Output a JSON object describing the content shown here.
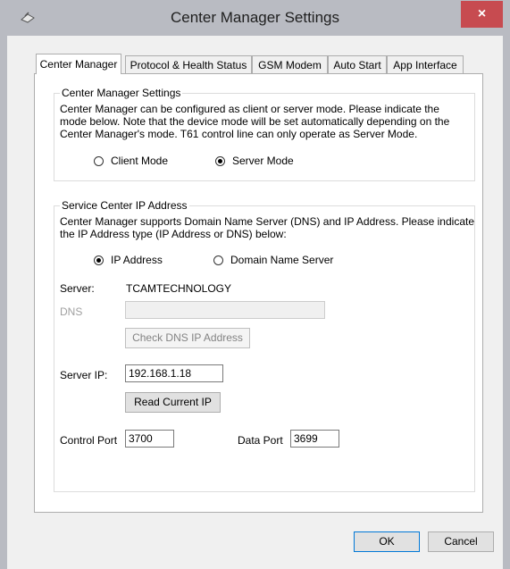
{
  "window": {
    "title": "Center Manager Settings",
    "close_glyph": "×",
    "icon": "app-icon"
  },
  "tabs": [
    {
      "label": "Center Manager",
      "active": true
    },
    {
      "label": "Protocol & Health Status",
      "active": false
    },
    {
      "label": "GSM Modem",
      "active": false
    },
    {
      "label": "Auto Start",
      "active": false
    },
    {
      "label": "App Interface",
      "active": false
    }
  ],
  "center_manager_group": {
    "title": "Center Manager Settings",
    "description_lines": [
      "Center Manager can be configured as client or server mode. Please indicate the",
      "mode below. Note that the device mode will be set automatically depending on the",
      "Center Manager's mode. T61 control line can only operate as Server Mode."
    ],
    "client_mode_label": "Client Mode",
    "server_mode_label": "Server Mode",
    "selected_mode": "Server Mode"
  },
  "service_center_group": {
    "title": "Service Center IP Address",
    "description_lines": [
      "Center Manager supports Domain Name Server (DNS) and IP Address. Please indicate",
      "the IP Address type (IP Address or DNS) below:"
    ],
    "ip_address_label": "IP Address",
    "dns_option_label": "Domain Name Server",
    "selected_type": "IP Address",
    "server_label": "Server:",
    "server_value": "TCAMTECHNOLOGY",
    "dns_label": "DNS",
    "dns_value": "",
    "check_dns_button": "Check DNS IP Address",
    "server_ip_label": "Server IP:",
    "server_ip_value": "192.168.1.18",
    "read_ip_button": "Read Current IP",
    "control_port_label": "Control Port",
    "control_port_value": "3700",
    "data_port_label": "Data Port",
    "data_port_value": "3699"
  },
  "footer": {
    "ok_label": "OK",
    "cancel_label": "Cancel"
  },
  "colors": {
    "titlebar": "#b9bbc2",
    "close_button": "#c74b50",
    "client_bg": "#f0f0f0",
    "default_button_border": "#0078d7"
  }
}
